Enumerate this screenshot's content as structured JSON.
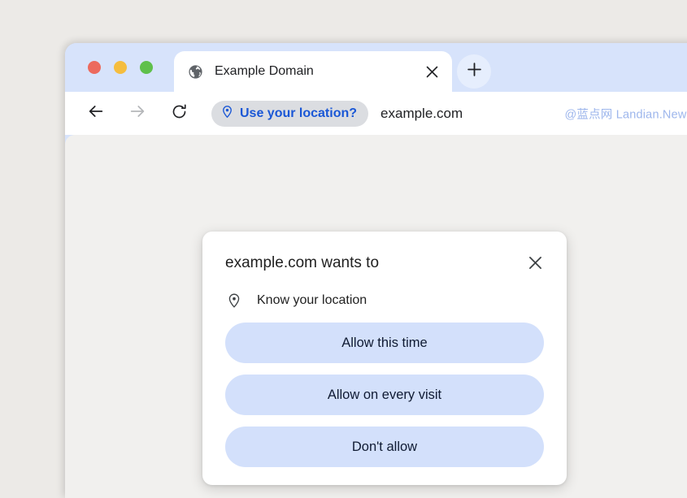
{
  "window": {
    "controls": [
      {
        "name": "close",
        "color": "#ec6a5e"
      },
      {
        "name": "minimize",
        "color": "#f5bd3e"
      },
      {
        "name": "zoom",
        "color": "#5fc04b"
      }
    ]
  },
  "tabstrip": {
    "tab": {
      "favicon": "globe-icon",
      "title": "Example Domain",
      "close_icon": "close-icon"
    },
    "new_tab_icon": "plus-icon"
  },
  "toolbar": {
    "back_icon": "arrow-left-icon",
    "forward_icon": "arrow-right-icon",
    "reload_icon": "reload-icon",
    "location_chip": {
      "icon": "location-pin-icon",
      "label": "Use your location?",
      "text_color": "#1a57d6",
      "background": "#dbdde1"
    },
    "url": "example.com",
    "watermark": "@蓝点网 Landian.News",
    "watermark_color": "#9db6ec"
  },
  "dialog": {
    "title": "example.com wants to",
    "close_icon": "close-icon",
    "permission": {
      "icon": "location-pin-icon",
      "label": "Know your location"
    },
    "buttons": [
      {
        "label": "Allow this time"
      },
      {
        "label": "Allow on every visit"
      },
      {
        "label": "Don't allow"
      }
    ],
    "button_background": "#d3e0fb"
  }
}
